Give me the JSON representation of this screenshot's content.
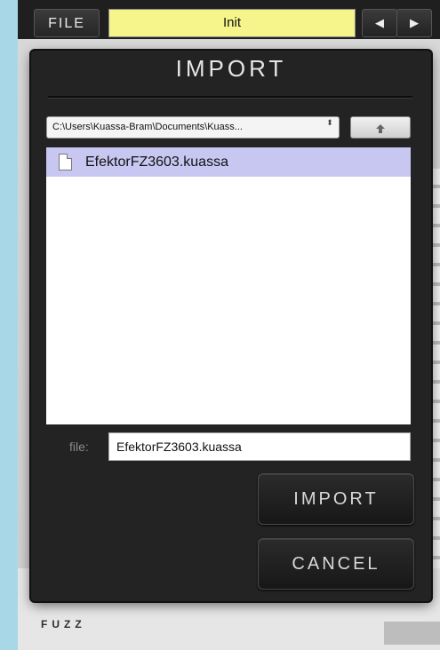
{
  "header": {
    "file_label": "FILE",
    "preset_name": "Init",
    "prev_glyph": "◀",
    "next_glyph": "▶"
  },
  "plugin": {
    "bottom_label": "FUZZ"
  },
  "dialog": {
    "title": "IMPORT",
    "path_value": "C:\\Users\\Kuassa-Bram\\Documents\\Kuass...",
    "path_arrows": "⬍",
    "up_icon": "up-arrow-icon",
    "files": [
      {
        "name": "EfektorFZ3603.kuassa",
        "selected": true
      }
    ],
    "file_label": "file:",
    "file_value": "EfektorFZ3603.kuassa",
    "import_label": "IMPORT",
    "cancel_label": "CANCEL"
  },
  "colors": {
    "preset_bg": "#f5f58c",
    "selected_row": "#c7c7f2",
    "dialog_bg": "#232323",
    "page_bg": "#a8d8e8"
  }
}
